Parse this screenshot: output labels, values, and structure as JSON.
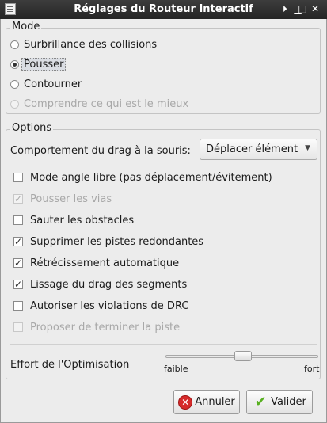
{
  "window": {
    "title": "Réglages du Routeur Interactif",
    "buttons": {
      "pin": "🞂",
      "minimize": "▁",
      "maximize": "□",
      "close": "✕"
    }
  },
  "mode": {
    "title": "Mode",
    "options": [
      {
        "label": "Surbrillance des collisions",
        "checked": false,
        "disabled": false
      },
      {
        "label": "Pousser",
        "checked": true,
        "disabled": false
      },
      {
        "label": "Contourner",
        "checked": false,
        "disabled": false
      },
      {
        "label": "Comprendre ce qui est le mieux",
        "checked": false,
        "disabled": true
      }
    ]
  },
  "options": {
    "title": "Options",
    "drag_label": "Comportement du drag à la souris:",
    "drag_value": "Déplacer élément",
    "checks": [
      {
        "label": "Mode angle libre (pas déplacement/évitement)",
        "checked": false,
        "disabled": false
      },
      {
        "label": "Pousser les vias",
        "checked": true,
        "disabled": true
      },
      {
        "label": "Sauter les obstacles",
        "checked": false,
        "disabled": false
      },
      {
        "label": "Supprimer les pistes redondantes",
        "checked": true,
        "disabled": false
      },
      {
        "label": "Rétrécissement automatique",
        "checked": true,
        "disabled": false
      },
      {
        "label": "Lissage du drag des segments",
        "checked": true,
        "disabled": false
      },
      {
        "label": "Autoriser les violations de DRC",
        "checked": false,
        "disabled": false
      },
      {
        "label": "Proposer de terminer la piste",
        "checked": false,
        "disabled": true
      }
    ],
    "effort_label": "Effort de l'Optimisation",
    "effort_min": "faible",
    "effort_max": "fort",
    "effort_level": 0.5
  },
  "footer": {
    "cancel_label": "Annuler",
    "ok_label": "Valider"
  }
}
